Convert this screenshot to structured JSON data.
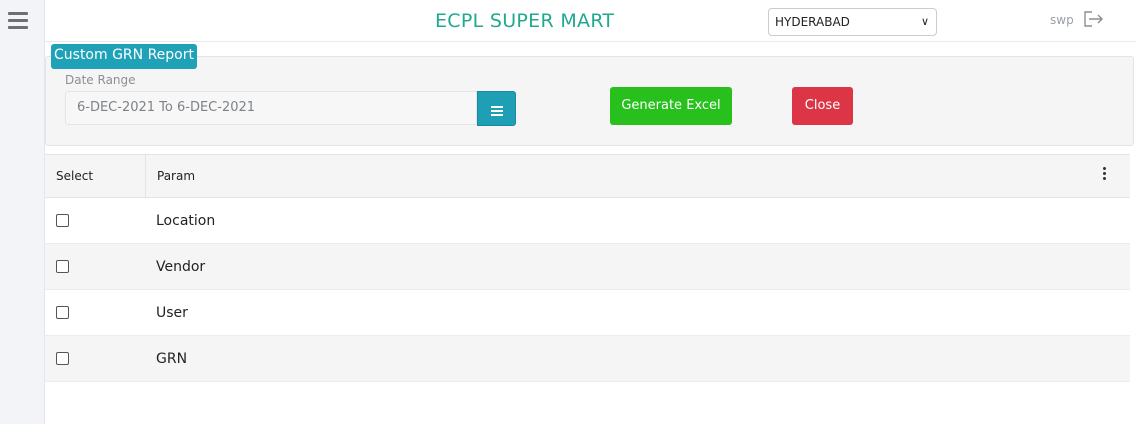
{
  "header": {
    "brand": "ECPL SUPER MART",
    "location_selected": "HYDERABAD",
    "user": "swp"
  },
  "panel": {
    "title": "Custom GRN Report",
    "date_label": "Date Range",
    "date_value": "6-DEC-2021 To 6-DEC-2021",
    "generate_label": "Generate Excel",
    "close_label": "Close"
  },
  "grid": {
    "columns": [
      "Select",
      "Param"
    ],
    "rows": [
      {
        "label": "Location"
      },
      {
        "label": "Vendor"
      },
      {
        "label": "User"
      },
      {
        "label": "GRN"
      }
    ]
  },
  "colors": {
    "brand": "#21a88f",
    "title_bg": "#1fa2b8",
    "generate_bg": "#27c01c",
    "close_bg": "#dc3545"
  },
  "icons": {
    "menu": "hamburger-icon",
    "logout": "logout-icon",
    "date_picker": "list-icon",
    "column_menu": "kebab-icon"
  }
}
